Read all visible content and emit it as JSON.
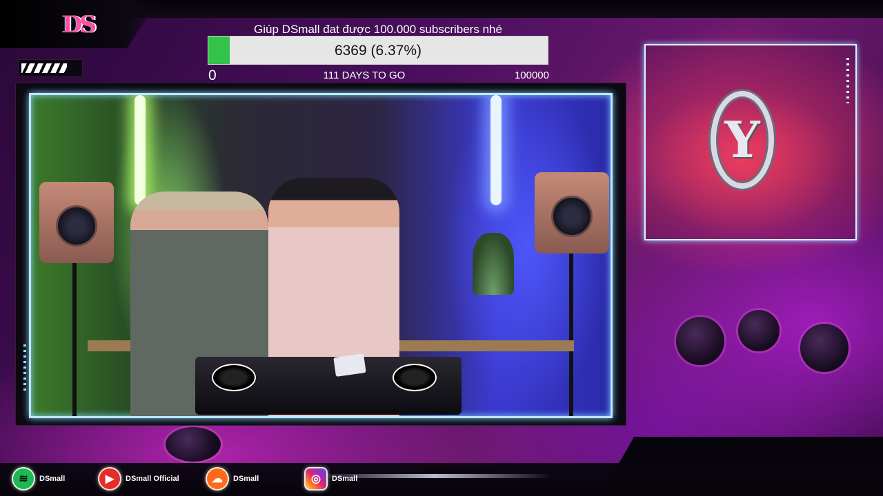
{
  "brand": {
    "logo_text": "DS"
  },
  "goal": {
    "title": "Giúp DSmall đat được 100.000 subscribers nhé",
    "current_text": "6369 (6.37%)",
    "progress_fraction": 0.0637,
    "min_label": "0",
    "days_label": "111 DAYS TO GO",
    "max_label": "100000",
    "fill_color": "#33c24a"
  },
  "side_panel": {
    "logo_glyph": "Y"
  },
  "socials": [
    {
      "icon": "spotify-icon",
      "glyph": "≋",
      "label": "DSmall"
    },
    {
      "icon": "youtube-icon",
      "glyph": "▶",
      "label": "DSmall Official"
    },
    {
      "icon": "soundcloud-icon",
      "glyph": "☁",
      "label": "DSmall"
    },
    {
      "icon": "instagram-icon",
      "glyph": "◎",
      "label": "DSmall"
    }
  ],
  "colors": {
    "frame_glow": "#7fd4ff",
    "accent_pink": "#ff4fa0"
  }
}
